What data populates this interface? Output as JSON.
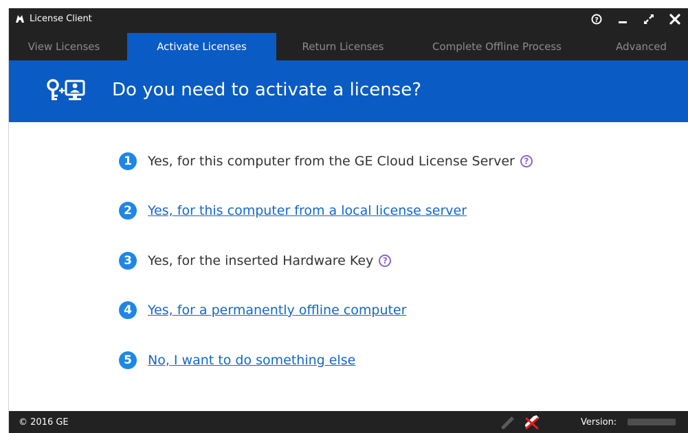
{
  "window": {
    "title": "License Client",
    "controls": [
      "help",
      "minimize",
      "maximize",
      "close"
    ]
  },
  "tabs": [
    {
      "label": "View Licenses",
      "active": false
    },
    {
      "label": "Activate Licenses",
      "active": true
    },
    {
      "label": "Return Licenses",
      "active": false
    },
    {
      "label": "Complete Offline Process",
      "active": false
    },
    {
      "label": "Advanced",
      "active": false
    }
  ],
  "banner": {
    "title": "Do you need to activate a license?",
    "icon": "key-computer-icon"
  },
  "options": [
    {
      "number": "1",
      "label": "Yes, for this computer from the GE Cloud License Server",
      "link": false,
      "help": true
    },
    {
      "number": "2",
      "label": "Yes, for this computer from a local license server",
      "link": true,
      "help": false
    },
    {
      "number": "3",
      "label": "Yes, for the inserted Hardware Key",
      "link": false,
      "help": true
    },
    {
      "number": "4",
      "label": "Yes, for a permanently offline computer",
      "link": true,
      "help": false
    },
    {
      "number": "5",
      "label": "No, I want to do something else",
      "link": true,
      "help": false
    }
  ],
  "help_glyph": "?",
  "status": {
    "copyright": "© 2016 GE",
    "version_label": "Version:"
  },
  "colors": {
    "titlebar": "#222222",
    "accent_blue": "#0a5bc4",
    "badge_blue": "#1e87e5",
    "link_blue": "#1467c8",
    "help_purple": "#8a63d2"
  }
}
